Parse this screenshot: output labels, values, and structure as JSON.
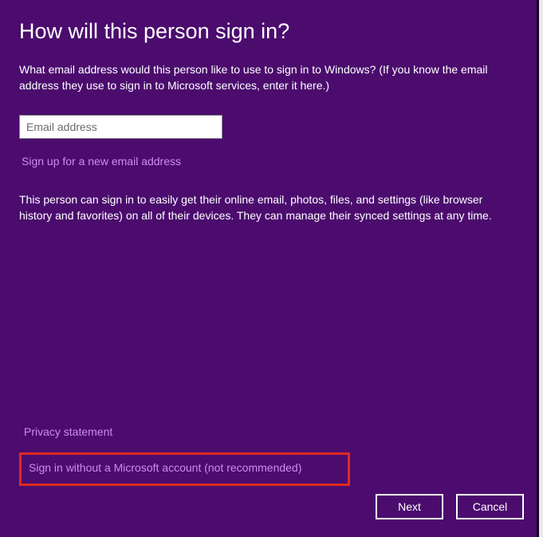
{
  "title": "How will this person sign in?",
  "intro": "What email address would this person like to use to sign in to Windows? (If you know the email address they use to sign in to Microsoft services, enter it here.)",
  "email_placeholder": "Email address",
  "signup_link": "Sign up for a new email address",
  "sync_text": "This person can sign in to easily get their online email, photos, files, and settings (like browser history and favorites) on all of their devices. They can manage their synced settings at any time.",
  "privacy_link": "Privacy statement",
  "no_ms_link": "Sign in without a Microsoft account (not recommended)",
  "buttons": {
    "next": "Next",
    "cancel": "Cancel"
  }
}
